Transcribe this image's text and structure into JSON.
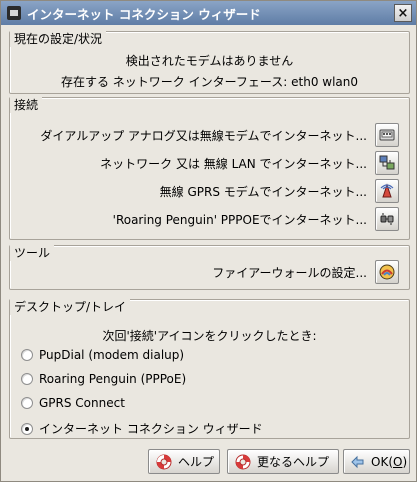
{
  "window": {
    "title": "インターネット コネクション ウィザード",
    "close_label": "×"
  },
  "status": {
    "title": "現在の設定/状況",
    "line1": "検出されたモデムはありません",
    "line2": "存在する ネットワーク インターフェース: eth0 wlan0"
  },
  "connect": {
    "title": "接続",
    "items": [
      {
        "label": "ダイアルアップ アナログ又は無線モデムでインターネット...",
        "icon": "dialup-icon"
      },
      {
        "label": "ネットワーク 又は 無線 LAN でインターネット...",
        "icon": "network-icon"
      },
      {
        "label": "無線 GPRS モデムでインターネット...",
        "icon": "antenna-icon"
      },
      {
        "label": "'Roaring Penguin' PPPOEでインターネット...",
        "icon": "plug-icon"
      }
    ]
  },
  "tools": {
    "title": "ツール",
    "firewall_label": "ファイアーウォールの設定...",
    "firewall_icon": "firewall-icon"
  },
  "desktop": {
    "title": "デスクトップ/トレイ",
    "intro": "次回'接続'アイコンをクリックしたとき:",
    "options": [
      {
        "label": "PupDial (modem dialup)",
        "checked": false
      },
      {
        "label": "Roaring Penguin (PPPoE)",
        "checked": false
      },
      {
        "label": "GPRS Connect",
        "checked": false
      },
      {
        "label": "インターネット コネクション ウィザード",
        "checked": true
      }
    ]
  },
  "buttons": {
    "help": "ヘルプ",
    "more_help": "更なるヘルプ",
    "ok_prefix": "OK(",
    "ok_mnemonic": "O",
    "ok_suffix": ")"
  },
  "colors": {
    "window_bg": "#eae7e0",
    "titlebar": "#6f8db3",
    "accent": "#d92f2f"
  }
}
